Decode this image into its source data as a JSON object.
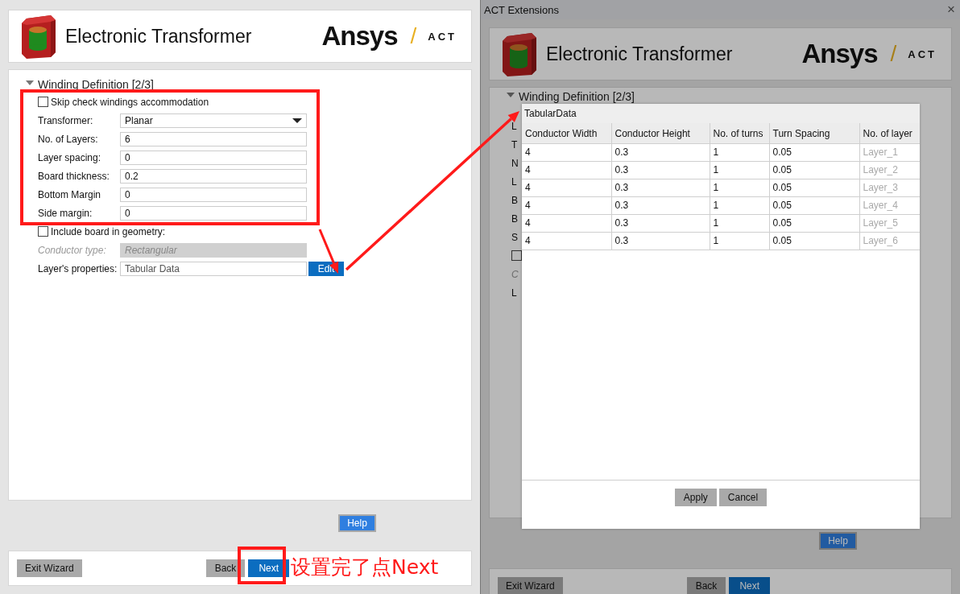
{
  "left_wizard": {
    "header": {
      "title": "Electronic Transformer",
      "brand": "Ansys",
      "separator": "/",
      "product": "ACT"
    },
    "section": {
      "title": "Winding Definition [2/3]",
      "expanded": true
    },
    "fields": [
      {
        "kind": "checkbox",
        "label": "Skip check windings accommodation",
        "checked": false,
        "disabled": false
      },
      {
        "kind": "dropdown",
        "label": "Transformer:",
        "value": "Planar",
        "disabled": false
      },
      {
        "kind": "text",
        "label": "No. of Layers:",
        "value": "6",
        "disabled": false
      },
      {
        "kind": "text",
        "label": "Layer spacing:",
        "value": "0",
        "disabled": false
      },
      {
        "kind": "text",
        "label": "Board thickness:",
        "value": "0.2",
        "disabled": false
      },
      {
        "kind": "text",
        "label": "Bottom Margin",
        "value": "0",
        "disabled": false
      },
      {
        "kind": "text",
        "label": "Side margin:",
        "value": "0",
        "disabled": false
      },
      {
        "kind": "checkbox",
        "label": "Include board in geometry:",
        "checked": false,
        "disabled": false
      },
      {
        "kind": "text",
        "label": "Conductor type:",
        "value": "Rectangular",
        "disabled": true
      },
      {
        "kind": "button_field",
        "label": "Layer's properties:",
        "value": "Tabular Data",
        "button": "Edit",
        "disabled": false
      }
    ],
    "help_button": "Help",
    "footer": {
      "exit": "Exit Wizard",
      "back": "Back",
      "next": "Next"
    }
  },
  "annotation": {
    "note": "设置完了点Next"
  },
  "dialog_window": {
    "title": "ACT Extensions",
    "close": "×",
    "background": {
      "dimmed": true,
      "header": {
        "title": "Electronic Transformer",
        "brand": "Ansys",
        "separator": "/",
        "product": "ACT"
      },
      "section": {
        "title": "Winding Definition [2/3]",
        "expanded": true
      },
      "fields": [
        {
          "kind": "text",
          "label": "L",
          "disabled": false
        },
        {
          "kind": "text",
          "label": "T",
          "disabled": false
        },
        {
          "kind": "text",
          "label": "N",
          "disabled": false
        },
        {
          "kind": "text",
          "label": "L",
          "disabled": false
        },
        {
          "kind": "text",
          "label": "B",
          "disabled": false
        },
        {
          "kind": "text",
          "label": "B",
          "disabled": false
        },
        {
          "kind": "text",
          "label": "S",
          "disabled": false
        },
        {
          "kind": "checkbox",
          "checked": false,
          "disabled": false
        },
        {
          "kind": "text",
          "label": "C",
          "disabled": true
        },
        {
          "kind": "text",
          "label": "L",
          "disabled": false
        }
      ],
      "help_button": "Help",
      "footer": {
        "exit": "Exit Wizard",
        "back": "Back",
        "next": "Next"
      }
    },
    "popup": {
      "title": "TabularData",
      "columns": [
        {
          "label": "Conductor Width",
          "editable": true
        },
        {
          "label": "Conductor Height",
          "editable": true
        },
        {
          "label": "No. of turns",
          "editable": true
        },
        {
          "label": "Turn Spacing",
          "editable": true
        },
        {
          "label": "No. of layer",
          "editable": false
        }
      ],
      "rows": [
        [
          "4",
          "0.3",
          "1",
          "0.05",
          "Layer_1"
        ],
        [
          "4",
          "0.3",
          "1",
          "0.05",
          "Layer_2"
        ],
        [
          "4",
          "0.3",
          "1",
          "0.05",
          "Layer_3"
        ],
        [
          "4",
          "0.3",
          "1",
          "0.05",
          "Layer_4"
        ],
        [
          "4",
          "0.3",
          "1",
          "0.05",
          "Layer_5"
        ],
        [
          "4",
          "0.3",
          "1",
          "0.05",
          "Layer_6"
        ]
      ],
      "buttons": [
        {
          "label": "Apply"
        },
        {
          "label": "Cancel"
        }
      ]
    }
  }
}
